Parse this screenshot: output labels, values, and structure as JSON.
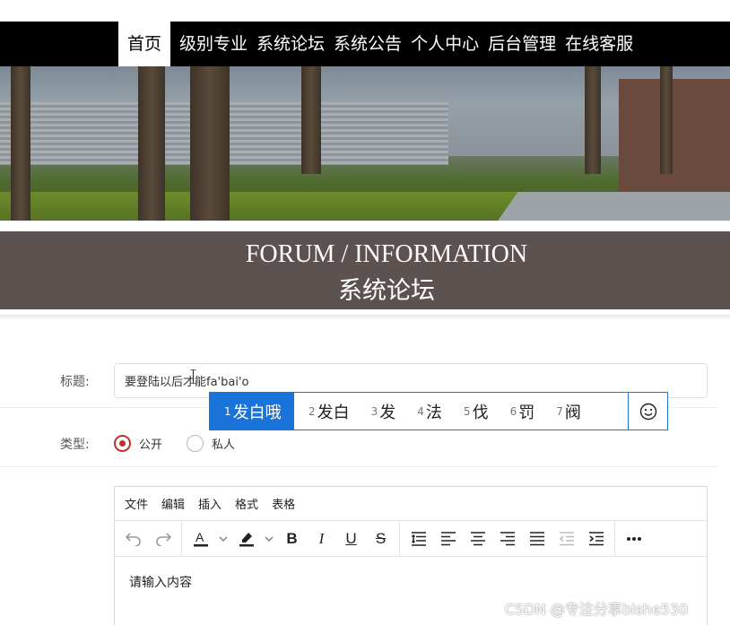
{
  "nav": {
    "items": [
      {
        "label": "首页",
        "active": true
      },
      {
        "label": "级别专业",
        "active": false
      },
      {
        "label": "系统论坛",
        "active": false
      },
      {
        "label": "系统公告",
        "active": false
      },
      {
        "label": "个人中心",
        "active": false
      },
      {
        "label": "后台管理",
        "active": false
      },
      {
        "label": "在线客服",
        "active": false
      }
    ]
  },
  "banner": {
    "slide_count": 3,
    "active_slide": 1
  },
  "section": {
    "title_en": "FORUM / INFORMATION",
    "title_cn": "系统论坛"
  },
  "form": {
    "title_label": "标题:",
    "title_value": "要登陆以后才能fa'bai'o",
    "type_label": "类型:",
    "type_options": [
      {
        "label": "公开",
        "checked": true
      },
      {
        "label": "私人",
        "checked": false
      }
    ]
  },
  "ime": {
    "candidates": [
      {
        "num": "1",
        "text": "发白哦",
        "selected": true
      },
      {
        "num": "2",
        "text": "发白",
        "selected": false
      },
      {
        "num": "3",
        "text": "发",
        "selected": false
      },
      {
        "num": "4",
        "text": "法",
        "selected": false
      },
      {
        "num": "5",
        "text": "伐",
        "selected": false
      },
      {
        "num": "6",
        "text": "罚",
        "selected": false
      },
      {
        "num": "7",
        "text": "阀",
        "selected": false
      }
    ],
    "emoji_icon": "smiley-icon"
  },
  "editor": {
    "menu": [
      "文件",
      "编辑",
      "插入",
      "格式",
      "表格"
    ],
    "placeholder": "请输入内容",
    "toolbar_icons": [
      "undo-icon",
      "redo-icon",
      "font-color-icon",
      "highlight-icon",
      "bold-icon",
      "italic-icon",
      "underline-icon",
      "strikethrough-icon",
      "line-height-icon",
      "align-left-icon",
      "align-center-icon",
      "align-right-icon",
      "justify-icon",
      "outdent-icon",
      "indent-icon",
      "more-icon"
    ],
    "bold": "B",
    "italic": "I",
    "underline": "U",
    "strike": "S",
    "font_color_letter": "A",
    "accent_color": "#c0302c"
  },
  "watermark": "CSDN @专注分享bishe530",
  "colors": {
    "nav_bg": "#000000",
    "header_bg": "#5c5250",
    "ime_blue": "#1a73d9",
    "radio_red": "#c0302c"
  }
}
